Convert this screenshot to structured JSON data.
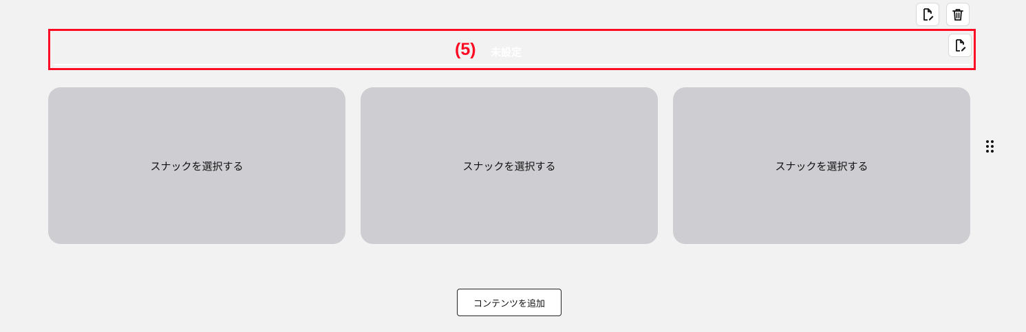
{
  "toolbar": {
    "edit_icon": "file-edit-icon",
    "delete_icon": "trash-icon"
  },
  "section_title": {
    "annotation": "(5)",
    "text": "未設定",
    "edit_icon": "file-edit-icon"
  },
  "cards": [
    {
      "label": "スナックを選択する"
    },
    {
      "label": "スナックを選択する"
    },
    {
      "label": "スナックを選択する"
    }
  ],
  "drag_handle_icon": "drag-dots-icon",
  "add_content_label": "コンテンツを追加",
  "colors": {
    "background": "#f2f2f2",
    "highlight": "#ff0a23",
    "card": "#cecdd2"
  }
}
